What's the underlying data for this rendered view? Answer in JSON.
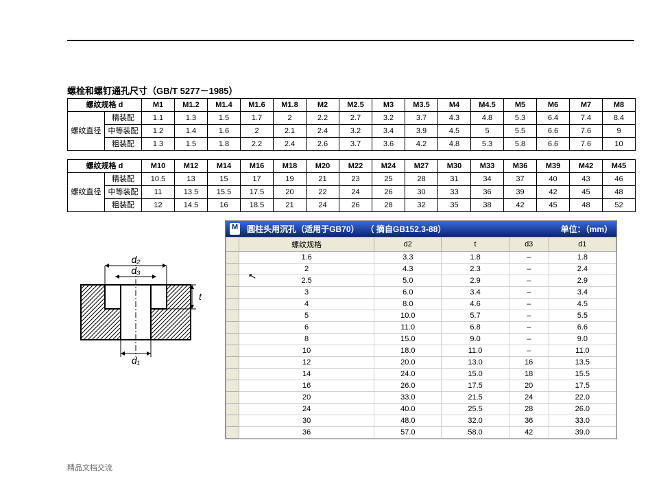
{
  "title": "螺栓和螺钉通孔尺寸（GB/T 5277－1985）",
  "table1": {
    "head_label": "螺纹规格 d",
    "side_label": "螺纹直径",
    "row_labels": [
      "精装配",
      "中等装配",
      "粗装配"
    ],
    "columns": [
      "M1",
      "M1.2",
      "M1.4",
      "M1.6",
      "M1.8",
      "M2",
      "M2.5",
      "M3",
      "M3.5",
      "M4",
      "M4.5",
      "M5",
      "M6",
      "M7",
      "M8"
    ],
    "rows": [
      [
        "1.1",
        "1.3",
        "1.5",
        "1.7",
        "2",
        "2.2",
        "2.7",
        "3.2",
        "3.7",
        "4.3",
        "4.8",
        "5.3",
        "6.4",
        "7.4",
        "8.4"
      ],
      [
        "1.2",
        "1.4",
        "1.6",
        "2",
        "2.1",
        "2.4",
        "3.2",
        "3.4",
        "3.9",
        "4.5",
        "5",
        "5.5",
        "6.6",
        "7.6",
        "9"
      ],
      [
        "1.3",
        "1.5",
        "1.8",
        "2.2",
        "2.4",
        "2.6",
        "3.7",
        "3.6",
        "4.2",
        "4.8",
        "5.3",
        "5.8",
        "6.6",
        "7.6",
        "10"
      ]
    ]
  },
  "table2": {
    "head_label": "螺纹规格 d",
    "side_label": "螺纹直径",
    "row_labels": [
      "精装配",
      "中等装配",
      "粗装配"
    ],
    "columns": [
      "M10",
      "M12",
      "M14",
      "M16",
      "M18",
      "M20",
      "M22",
      "M24",
      "M27",
      "M30",
      "M33",
      "M36",
      "M39",
      "M42",
      "M45"
    ],
    "rows": [
      [
        "10.5",
        "13",
        "15",
        "17",
        "19",
        "21",
        "23",
        "25",
        "28",
        "31",
        "34",
        "37",
        "40",
        "43",
        "46"
      ],
      [
        "11",
        "13.5",
        "15.5",
        "17.5",
        "20",
        "22",
        "24",
        "26",
        "30",
        "33",
        "36",
        "39",
        "42",
        "45",
        "48"
      ],
      [
        "12",
        "14.5",
        "16",
        "18.5",
        "21",
        "24",
        "26",
        "28",
        "32",
        "35",
        "38",
        "42",
        "45",
        "48",
        "52"
      ]
    ]
  },
  "panel_title_parts": {
    "badge": "M",
    "text1": "圆柱头用沉孔（适用于GB70）",
    "text2": "（ 摘自GB152.3-88）",
    "unit": "单位：（mm）"
  },
  "grid": {
    "headers": [
      "螺纹规格",
      "d2",
      "t",
      "d3",
      "d1"
    ],
    "rows": [
      [
        "1.6",
        "3.3",
        "1.8",
        "–",
        "1.8"
      ],
      [
        "2",
        "4.3",
        "2.3",
        "–",
        "2.4"
      ],
      [
        "2.5",
        "5.0",
        "2.9",
        "–",
        "2.9"
      ],
      [
        "3",
        "6.0",
        "3.4",
        "–",
        "3.4"
      ],
      [
        "4",
        "8.0",
        "4.6",
        "–",
        "4.5"
      ],
      [
        "5",
        "10.0",
        "5.7",
        "–",
        "5.5"
      ],
      [
        "6",
        "11.0",
        "6.8",
        "–",
        "6.6"
      ],
      [
        "8",
        "15.0",
        "9.0",
        "–",
        "9.0"
      ],
      [
        "10",
        "18.0",
        "11.0",
        "–",
        "11.0"
      ],
      [
        "12",
        "20.0",
        "13.0",
        "16",
        "13.5"
      ],
      [
        "14",
        "24.0",
        "15.0",
        "18",
        "15.5"
      ],
      [
        "16",
        "26.0",
        "17.5",
        "20",
        "17.5"
      ],
      [
        "20",
        "33.0",
        "21.5",
        "24",
        "22.0"
      ],
      [
        "24",
        "40.0",
        "25.5",
        "28",
        "26.0"
      ],
      [
        "30",
        "48.0",
        "32.0",
        "36",
        "33.0"
      ],
      [
        "36",
        "57.0",
        "58.0",
        "42",
        "39.0"
      ]
    ]
  },
  "diagram_labels": {
    "d1": "d₁",
    "d2": "d₂",
    "d3": "d₃",
    "t": "t"
  },
  "footer": "精品文档交流"
}
